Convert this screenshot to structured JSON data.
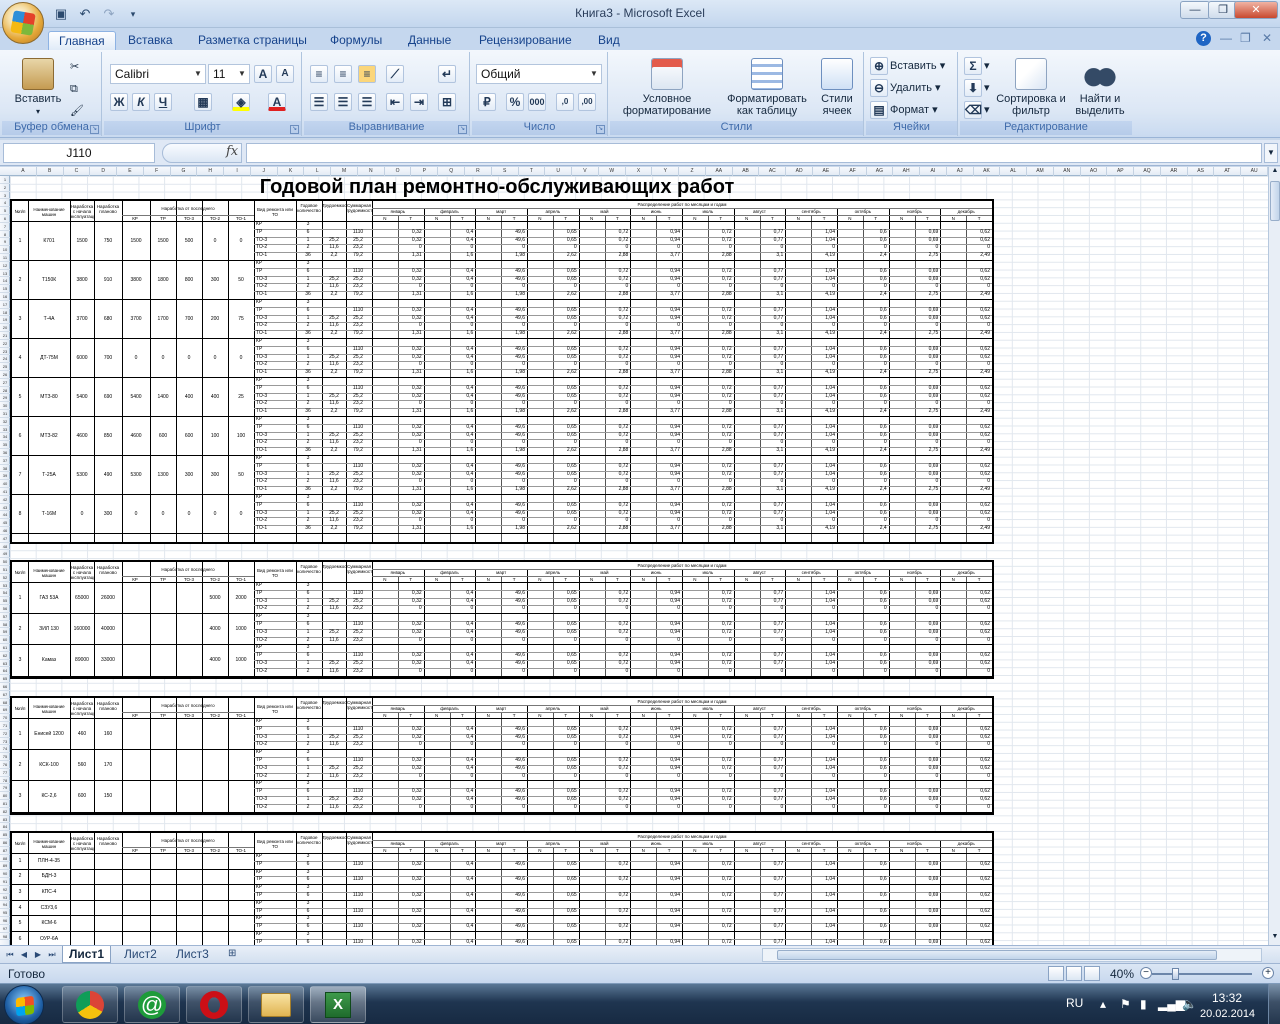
{
  "window": {
    "title": "Книга3 - Microsoft Excel"
  },
  "ribbon_tabs": [
    "Главная",
    "Вставка",
    "Разметка страницы",
    "Формулы",
    "Данные",
    "Рецензирование",
    "Вид"
  ],
  "ribbon": {
    "clipboard": {
      "label": "Буфер обмена",
      "paste": "Вставить"
    },
    "font": {
      "label": "Шрифт",
      "name": "Calibri",
      "size": "11"
    },
    "alignment": {
      "label": "Выравнивание"
    },
    "number": {
      "label": "Число",
      "format": "Общий"
    },
    "styles": {
      "label": "Стили",
      "conditional": "Условное форматирование",
      "as_table": "Форматировать как таблицу",
      "cell_styles": "Стили ячеек"
    },
    "cells": {
      "label": "Ячейки",
      "insert": "Вставить",
      "delete": "Удалить",
      "format": "Формат"
    },
    "editing": {
      "label": "Редактирование",
      "sort": "Сортировка и фильтр",
      "find": "Найти и выделить"
    }
  },
  "formula_bar": {
    "name_box": "J110",
    "fx": "fx",
    "value": ""
  },
  "sheet": {
    "title": "Годовой план ремонтно-обслуживающих работ",
    "col_headers": [
      "A",
      "B",
      "C",
      "D",
      "E",
      "F",
      "G",
      "H",
      "I",
      "J",
      "K",
      "L",
      "M",
      "N",
      "O",
      "P",
      "Q",
      "R",
      "S",
      "T",
      "U",
      "V",
      "W",
      "X",
      "Y",
      "Z",
      "AA",
      "AB",
      "AC",
      "AD",
      "AE",
      "AF",
      "AG",
      "AH",
      "AI",
      "AJ",
      "AK",
      "AL",
      "AM",
      "AN",
      "AO",
      "AP",
      "AQ",
      "AR",
      "AS",
      "AT",
      "AU"
    ],
    "header_labels": {
      "num": "№п/п",
      "name": "Наименование машин",
      "since_start": "Наработка с начала эксплуатации",
      "plan": "Наработка планово",
      "since_last": "Наработка от последнего",
      "kind": "Вид ремонта или ТО",
      "count": "Годовое количество",
      "labour": "Трудоемкость",
      "total": "Суммарная трудоемкость",
      "distribution": "Распределение работ по месяцам и годам",
      "sub": [
        "КР",
        "ТР",
        "ТО-3",
        "ТО-2",
        "ТО-1"
      ],
      "months": [
        "январь",
        "февраль",
        "март",
        "апрель",
        "май",
        "июнь",
        "июль",
        "август",
        "сентябрь",
        "октябрь",
        "ноябрь",
        "декабрь"
      ],
      "nt": [
        "N",
        "T"
      ]
    },
    "block1_machines": [
      {
        "n": "1",
        "name": "К701",
        "a": "1500",
        "b": "750",
        "c": "1500",
        "d": "1500",
        "e": "500",
        "f": "0",
        "g": "0"
      },
      {
        "n": "2",
        "name": "Т150К",
        "a": "3800",
        "b": "910",
        "c": "3800",
        "d": "1800",
        "e": "800",
        "f": "300",
        "g": "50"
      },
      {
        "n": "3",
        "name": "Т-4А",
        "a": "3700",
        "b": "680",
        "c": "3700",
        "d": "1700",
        "e": "700",
        "f": "200",
        "g": "75"
      },
      {
        "n": "4",
        "name": "ДТ-75М",
        "a": "6000",
        "b": "700",
        "c": "0",
        "d": "0",
        "e": "0",
        "f": "0",
        "g": "0"
      },
      {
        "n": "5",
        "name": "МТЗ-80",
        "a": "5400",
        "b": "690",
        "c": "5400",
        "d": "1400",
        "e": "400",
        "f": "400",
        "g": "25"
      },
      {
        "n": "6",
        "name": "МТЗ-82",
        "a": "4600",
        "b": "850",
        "c": "4600",
        "d": "600",
        "e": "600",
        "f": "100",
        "g": "100"
      },
      {
        "n": "7",
        "name": "Т-25А",
        "a": "5300",
        "b": "490",
        "c": "5300",
        "d": "1300",
        "e": "300",
        "f": "300",
        "g": "50"
      },
      {
        "n": "8",
        "name": "Т-16М",
        "a": "0",
        "b": "300",
        "c": "0",
        "d": "0",
        "e": "0",
        "f": "0",
        "g": "0"
      }
    ],
    "block2_machines": [
      {
        "n": "1",
        "name": "ГАЗ 53А",
        "a": "65000",
        "b": "26000",
        "f": "5000",
        "g": "2000"
      },
      {
        "n": "2",
        "name": "ЗИЛ 130",
        "a": "160000",
        "b": "40000",
        "f": "4000",
        "g": "1000"
      },
      {
        "n": "3",
        "name": "Камаз",
        "a": "89000",
        "b": "33000",
        "f": "4000",
        "g": "1000"
      }
    ],
    "block3_machines": [
      {
        "n": "1",
        "name": "Енисей 1200",
        "a": "460",
        "b": "160"
      },
      {
        "n": "2",
        "name": "КСК-100",
        "a": "560",
        "b": "170"
      },
      {
        "n": "3",
        "name": "КС-2,6",
        "a": "600",
        "b": "150"
      }
    ],
    "block4_machines": [
      {
        "n": "1",
        "name": "ПЛН-4-35"
      },
      {
        "n": "2",
        "name": "БДН-3"
      },
      {
        "n": "3",
        "name": "КПС-4"
      },
      {
        "n": "4",
        "name": "СЗУ3,6"
      },
      {
        "n": "5",
        "name": "КСМ-6"
      },
      {
        "n": "6",
        "name": "ОУР-6А"
      }
    ],
    "kinds": [
      "КР",
      "ТР",
      "ТО-3",
      "ТО-2",
      "ТО-1"
    ],
    "sample_rows": [
      [
        "КР",
        "3",
        "",
        "",
        "",
        "",
        "",
        "",
        "",
        "",
        "",
        "",
        "",
        "",
        "",
        "",
        "",
        "",
        "",
        "",
        "",
        "",
        "",
        "",
        "",
        ""
      ],
      [
        "ТР",
        "6",
        "",
        "1110",
        "",
        "0,32",
        "",
        "0,4",
        "",
        "49,6",
        "",
        "0,65",
        "",
        "0,72",
        "",
        "0,94",
        "",
        "0,72",
        "",
        "0,77",
        "",
        "1,04",
        "",
        "0,6",
        "",
        "0,69",
        "",
        "0,62"
      ],
      [
        "ТО-3",
        "1",
        "25,2",
        "25,2",
        "",
        "0,32",
        "",
        "0,4",
        "",
        "49,6",
        "",
        "0,65",
        "",
        "0,72",
        "",
        "0,94",
        "",
        "0,72",
        "",
        "0,77",
        "",
        "1,04",
        "",
        "0,6",
        "",
        "0,69",
        "",
        "0,62"
      ],
      [
        "ТО-2",
        "2",
        "11,6",
        "23,2",
        "",
        "0",
        "",
        "0",
        "",
        "0",
        "",
        "0",
        "",
        "0",
        "",
        "0",
        "",
        "0",
        "",
        "0",
        "",
        "0",
        "",
        "0",
        "",
        "0",
        "",
        "0"
      ],
      [
        "ТО-1",
        "36",
        "2,2",
        "79,2",
        "",
        "1,31",
        "",
        "1,6",
        "",
        "1,98",
        "",
        "2,62",
        "",
        "2,88",
        "",
        "3,77",
        "",
        "2,88",
        "",
        "3,1",
        "",
        "4,19",
        "",
        "2,4",
        "",
        "2,75",
        "",
        "2,49"
      ]
    ]
  },
  "sheet_tabs": [
    "Лист1",
    "Лист2",
    "Лист3"
  ],
  "status": {
    "text": "Готово",
    "zoom": "40%"
  },
  "taskbar": {
    "lang": "RU",
    "time": "13:32",
    "date": "20.02.2014"
  }
}
